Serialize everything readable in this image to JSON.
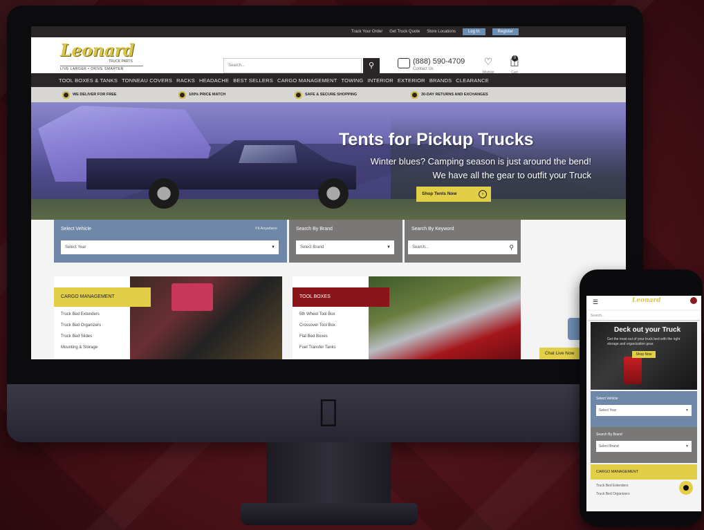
{
  "topbar": {
    "links": [
      "Track Your Order",
      "Get Truck Quote",
      "Store Locations"
    ],
    "login_label": "Log In",
    "register_label": "Register"
  },
  "header": {
    "logo_main": "Leonard",
    "logo_sub": "TRUCK PARTS",
    "logo_tag": "LIVE LARGER • DRIVE SMARTER",
    "search_placeholder": "Search...",
    "phone_number": "(888) 590-4709",
    "phone_sub": "Contact Us",
    "wishlist_label": "Wishlist",
    "cart_label": "Cart",
    "cart_count": "0"
  },
  "nav": {
    "items": [
      "TOOL BOXES & TANKS",
      "TONNEAU COVERS",
      "RACKS",
      "HEADACHE",
      "BEST SELLERS",
      "CARGO MANAGEMENT",
      "TOWING",
      "INTERIOR",
      "EXTERIOR",
      "BRANDS",
      "CLEARANCE"
    ]
  },
  "benefits": [
    "WE DELIVER FOR FREE",
    "100% PRICE MATCH",
    "SAFE & SECURE SHOPPING",
    "30-DAY RETURNS AND EXCHANGES"
  ],
  "hero": {
    "title": "Tents for Pickup Trucks",
    "subtitle_line1": "Winter blues? Camping season is just around the bend!",
    "subtitle_line2": "We have all the gear to outfit your Truck",
    "button_label": "Shop Tents Now"
  },
  "search_panels": {
    "vehicle_title": "Select Vehicle",
    "vehicle_tip": "Fit Anywhere",
    "vehicle_field": "Select Year",
    "brand_title": "Search By Brand",
    "brand_field": "Select Brand",
    "keyword_title": "Search By Keyword",
    "keyword_placeholder": "Search..."
  },
  "tiles": {
    "cargo": {
      "title": "CARGO MANAGEMENT",
      "items": [
        "Truck Bed Extenders",
        "Truck Bed Organizers",
        "Truck Bed Slides",
        "Mounting & Storage"
      ]
    },
    "toolboxes": {
      "title": "TOOL BOXES",
      "items": [
        "5th Wheel Tool Box",
        "Crossover Tool Box",
        "Flat Bed Boxes",
        "Fuel Transfer Tanks"
      ]
    }
  },
  "chat_label": "Chat Live Now",
  "phone": {
    "logo": "Leonard",
    "search_placeholder": "Search...",
    "hero_title": "Deck out your Truck",
    "hero_sub": "Get the most out of your truck bed with the right storage and organization gear.",
    "hero_button": "Shop Now",
    "vehicle_title": "Select Vehicle",
    "vehicle_field": "Select Year",
    "brand_title": "Search By Brand",
    "brand_field": "Select Brand",
    "cat_title": "CARGO MANAGEMENT",
    "cat_items": [
      "Truck Bed Extenders",
      "Truck Bed Organizers"
    ]
  },
  "colors": {
    "accent_yellow": "#e2cf47",
    "nav_dark": "#2b2628",
    "panel_blue": "#6f88a8",
    "panel_gray": "#7a7777",
    "tool_red": "#8a141a"
  }
}
